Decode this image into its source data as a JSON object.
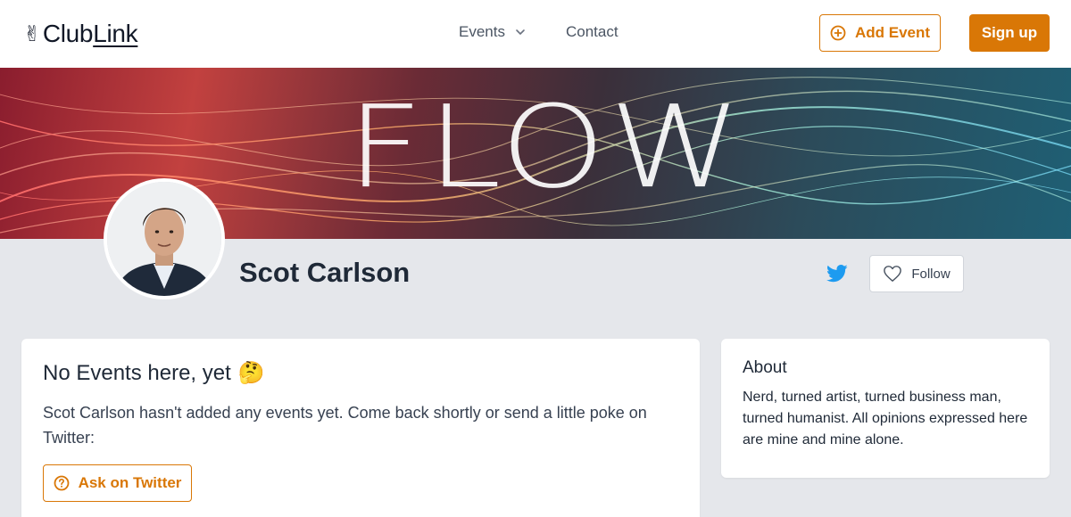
{
  "brand": {
    "emoji": "✌",
    "name_part1": "Club",
    "name_part2": "Link"
  },
  "nav": {
    "events_label": "Events",
    "contact_label": "Contact",
    "add_event_label": "Add Event",
    "signup_label": "Sign up"
  },
  "banner": {
    "word": "FLOW"
  },
  "profile": {
    "name": "Scot Carlson",
    "follow_label": "Follow"
  },
  "events_card": {
    "title": "No Events here, yet",
    "title_emoji": "🤔",
    "message": "Scot Carlson hasn't added any events yet. Come back shortly or send a little poke on Twitter:",
    "ask_label": "Ask on Twitter"
  },
  "about_card": {
    "title": "About",
    "bio": "Nerd, turned artist, turned business man, turned humanist. All opinions expressed here are mine and mine alone."
  },
  "colors": {
    "accent": "#d97706",
    "twitter": "#1d9bf0",
    "page_bg": "#e5e7eb"
  },
  "icons": {
    "logo": "victory-hand-icon",
    "events_dropdown": "chevron-down-icon",
    "add_event": "plus-circle-icon",
    "twitter": "twitter-icon",
    "follow": "heart-icon",
    "ask": "question-circle-icon"
  }
}
